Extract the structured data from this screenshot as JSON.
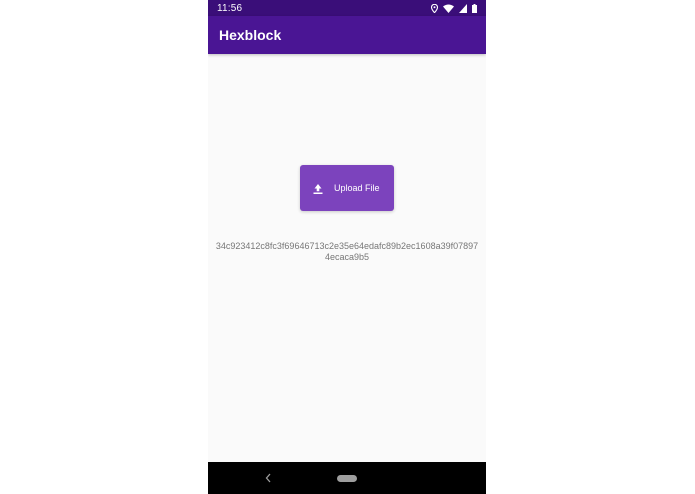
{
  "status_bar": {
    "time": "11:56"
  },
  "app_bar": {
    "title": "Hexblock"
  },
  "main": {
    "upload_button_label": "Upload File",
    "hash": "34c923412c8fc3f69646713c2e35e64edafc89b2ec1608a39f078974ecaca9b5"
  },
  "icons": {
    "status": [
      "location-icon",
      "wifi-icon",
      "signal-icon",
      "battery-icon"
    ],
    "upload": "upload-icon",
    "nav": [
      "back-icon",
      "home-pill"
    ]
  },
  "colors": {
    "status_bar": "#3a0e79",
    "app_bar": "#4a1594",
    "button": "#7c43bd",
    "background": "#fafafa",
    "hash_text": "#777777"
  }
}
